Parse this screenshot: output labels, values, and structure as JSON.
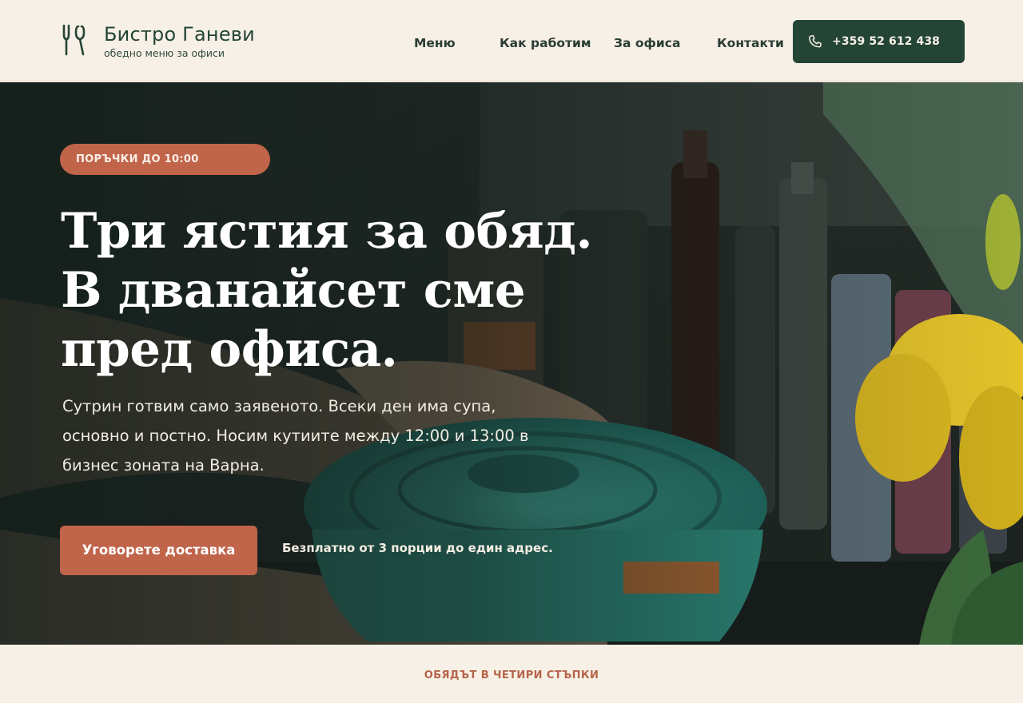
{
  "brand": {
    "name": "Бистро Ганеви",
    "tagline": "обедно меню за офиси",
    "icon": "fork-spoon-icon"
  },
  "nav": {
    "items": [
      {
        "label": "Меню"
      },
      {
        "label": "Как работим"
      },
      {
        "label": "За офиса"
      },
      {
        "label": "Контакти"
      }
    ],
    "phone": {
      "label": "+359 52 612 438",
      "icon": "phone-icon"
    }
  },
  "hero": {
    "badge": "ПОРЪЧКИ ДО 10:00",
    "headline_lines": [
      "Три ястия за обяд.",
      "В дванайсет сме",
      "пред офиса."
    ],
    "subtext_lines": [
      "Сутрин готвим само заявеното. Всеки ден има супа,",
      "основно и постно. Носим кутиите между 12:00 и 13:00 в",
      "бизнес зоната на Варна."
    ],
    "cta_label": "Уговорете доставка",
    "cta_note": "Безплатно от 3 порции до един адрес."
  },
  "steps": {
    "eyebrow": "ОБЯДЪТ В ЧЕТИРИ СТЪПКИ"
  },
  "colors": {
    "page_bg": "#f7f0e6",
    "brand_green": "#244536",
    "accent_terracotta": "#c0644a",
    "eyebrow": "#b5644a"
  }
}
